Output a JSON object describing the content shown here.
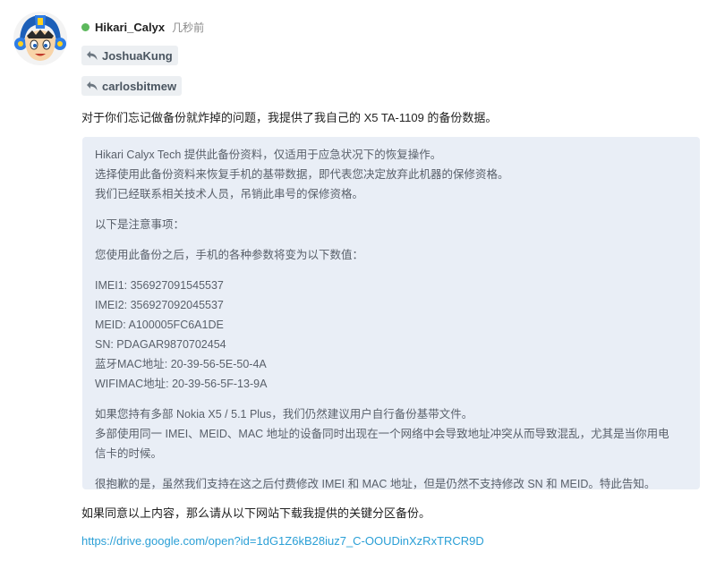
{
  "post": {
    "username": "Hikari_Calyx",
    "time": "几秒前",
    "status_color": "#5cb85c",
    "avatar_icon": "megaman-avatar-icon",
    "replies": [
      "JoshuaKung",
      "carlosbitmew"
    ],
    "reply_icon": "reply-arrow-icon",
    "intro": "对于你们忘记做备份就炸掉的问题，我提供了我自己的 X5 TA-1109 的备份数据。",
    "quote": {
      "p1": [
        "Hikari Calyx Tech 提供此备份资料，仅适用于应急状况下的恢复操作。",
        "选择使用此备份资料来恢复手机的基带数据，即代表您决定放弃此机器的保修资格。",
        "我们已经联系相关技术人员，吊销此串号的保修资格。"
      ],
      "notice": "以下是注意事项：",
      "change_note": "您使用此备份之后，手机的各种参数将变为以下数值：",
      "values": [
        "IMEI1: 356927091545537",
        "IMEI2: 356927092045537",
        "MEID: A100005FC6A1DE",
        "SN: PDAGAR9870702454",
        "蓝牙MAC地址: 20-39-56-5E-50-4A",
        "WIFIMAC地址: 20-39-56-5F-13-9A"
      ],
      "multi_device": [
        "如果您持有多部 Nokia X5 / 5.1 Plus，我们仍然建议用户自行备份基带文件。",
        "多部使用同一 IMEI、MEID、MAC 地址的设备同时出现在一个网络中会导致地址冲突从而导致混乱，尤其是当你用电",
        "信卡的时候。"
      ],
      "apology": "很抱歉的是，虽然我们支持在这之后付费修改 IMEI 和 MAC 地址，但是仍然不支持修改 SN 和 MEID。特此告知。"
    },
    "footer_text": "如果同意以上内容，那么请从以下网站下载我提供的关键分区备份。",
    "link": "https://drive.google.com/open?id=1dG1Z6kB28iuz7_C-OOUDinXzRxTRCR9D",
    "link_color": "#2a9fd6"
  }
}
